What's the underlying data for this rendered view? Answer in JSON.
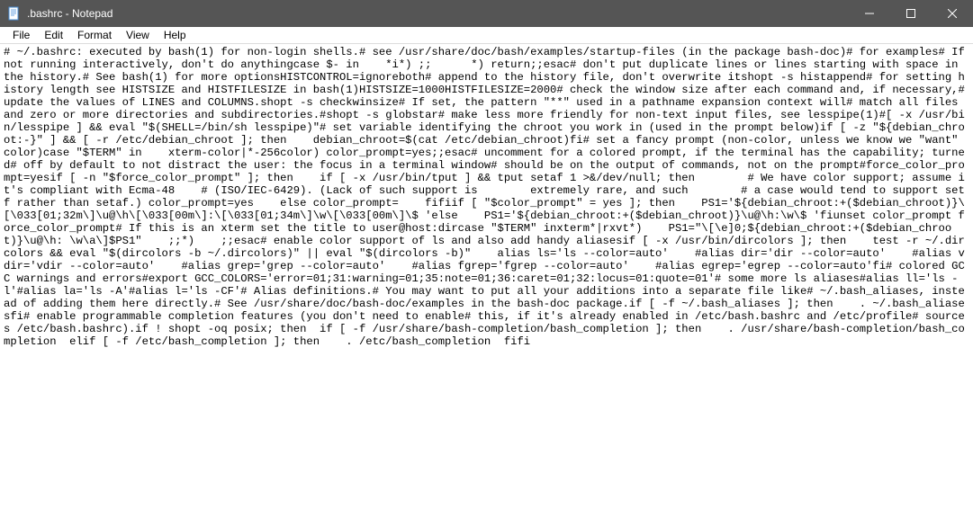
{
  "window": {
    "title": ".bashrc - Notepad"
  },
  "menubar": {
    "file": "File",
    "edit": "Edit",
    "format": "Format",
    "view": "View",
    "help": "Help"
  },
  "content": "# ~/.bashrc: executed by bash(1) for non-login shells.# see /usr/share/doc/bash/examples/startup-files (in the package bash-doc)# for examples# If not running interactively, don't do anythingcase $- in    *i*) ;;      *) return;;esac# don't put duplicate lines or lines starting with space in the history.# See bash(1) for more optionsHISTCONTROL=ignoreboth# append to the history file, don't overwrite itshopt -s histappend# for setting history length see HISTSIZE and HISTFILESIZE in bash(1)HISTSIZE=1000HISTFILESIZE=2000# check the window size after each command and, if necessary,# update the values of LINES and COLUMNS.shopt -s checkwinsize# If set, the pattern \"**\" used in a pathname expansion context will# match all files and zero or more directories and subdirectories.#shopt -s globstar# make less more friendly for non-text input files, see lesspipe(1)#[ -x /usr/bin/lesspipe ] && eval \"$(SHELL=/bin/sh lesspipe)\"# set variable identifying the chroot you work in (used in the prompt below)if [ -z \"${debian_chroot:-}\" ] && [ -r /etc/debian_chroot ]; then    debian_chroot=$(cat /etc/debian_chroot)fi# set a fancy prompt (non-color, unless we know we \"want\" color)case \"$TERM\" in    xterm-color|*-256color) color_prompt=yes;;esac# uncomment for a colored prompt, if the terminal has the capability; turned# off by default to not distract the user: the focus in a terminal window# should be on the output of commands, not on the prompt#force_color_prompt=yesif [ -n \"$force_color_prompt\" ]; then    if [ -x /usr/bin/tput ] && tput setaf 1 >&/dev/null; then        # We have color support; assume it's compliant with Ecma-48    # (ISO/IEC-6429). (Lack of such support is        extremely rare, and such        # a case would tend to support setf rather than setaf.) color_prompt=yes    else color_prompt=    fifiif [ \"$color_prompt\" = yes ]; then    PS1='${debian_chroot:+($debian_chroot)}\\[\\033[01;32m\\]\\u@\\h\\[\\033[00m\\]:\\[\\033[01;34m\\]\\w\\[\\033[00m\\]\\$ 'else    PS1='${debian_chroot:+($debian_chroot)}\\u@\\h:\\w\\$ 'fiunset color_prompt force_color_prompt# If this is an xterm set the title to user@host:dircase \"$TERM\" inxterm*|rxvt*)    PS1=\"\\[\\e]0;${debian_chroot:+($debian_chroot)}\\u@\\h: \\w\\a\\]$PS1\"    ;;*)    ;;esac# enable color support of ls and also add handy aliasesif [ -x /usr/bin/dircolors ]; then    test -r ~/.dircolors && eval \"$(dircolors -b ~/.dircolors)\" || eval \"$(dircolors -b)\"    alias ls='ls --color=auto'    #alias dir='dir --color=auto'    #alias vdir='vdir --color=auto'    #alias grep='grep --color=auto'    #alias fgrep='fgrep --color=auto'    #alias egrep='egrep --color=auto'fi# colored GCC warnings and errors#export GCC_COLORS='error=01;31:warning=01;35:note=01;36:caret=01;32:locus=01:quote=01'# some more ls aliases#alias ll='ls -l'#alias la='ls -A'#alias l='ls -CF'# Alias definitions.# You may want to put all your additions into a separate file like# ~/.bash_aliases, instead of adding them here directly.# See /usr/share/doc/bash-doc/examples in the bash-doc package.if [ -f ~/.bash_aliases ]; then    . ~/.bash_aliasesfi# enable programmable completion features (you don't need to enable# this, if it's already enabled in /etc/bash.bashrc and /etc/profile# sources /etc/bash.bashrc).if ! shopt -oq posix; then  if [ -f /usr/share/bash-completion/bash_completion ]; then    . /usr/share/bash-completion/bash_completion  elif [ -f /etc/bash_completion ]; then    . /etc/bash_completion  fifi"
}
